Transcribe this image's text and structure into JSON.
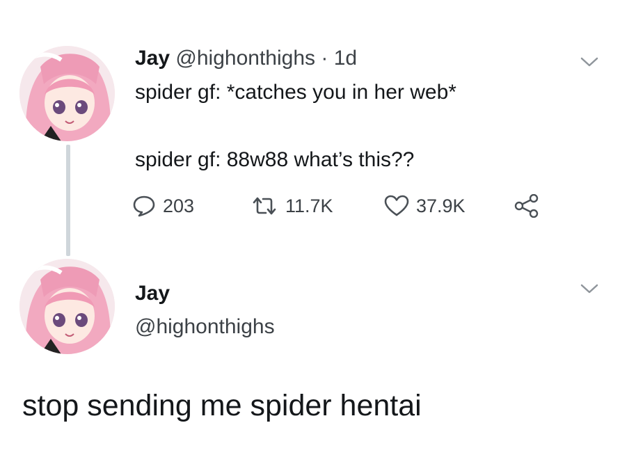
{
  "original_tweet": {
    "author_name": "Jay",
    "author_handle": "@highonthighs",
    "separator": "·",
    "time_ago": "1d",
    "lines": [
      "spider gf: *catches you in her web*",
      "spider gf: 88w88 what’s this??"
    ],
    "actions": {
      "reply_count": "203",
      "retweet_count": "11.7K",
      "like_count": "37.9K",
      "reply_icon": "speech-bubble-icon",
      "retweet_icon": "retweet-icon",
      "like_icon": "heart-icon",
      "share_icon": "share-icon"
    }
  },
  "reply_tweet": {
    "author_name": "Jay",
    "author_handle": "@highonthighs",
    "body": "stop sending me spider hentai"
  },
  "colors": {
    "text": "#14171a",
    "secondary_text": "#3c4146",
    "thread_line": "#cfd6db",
    "icon": "#4a5056"
  }
}
